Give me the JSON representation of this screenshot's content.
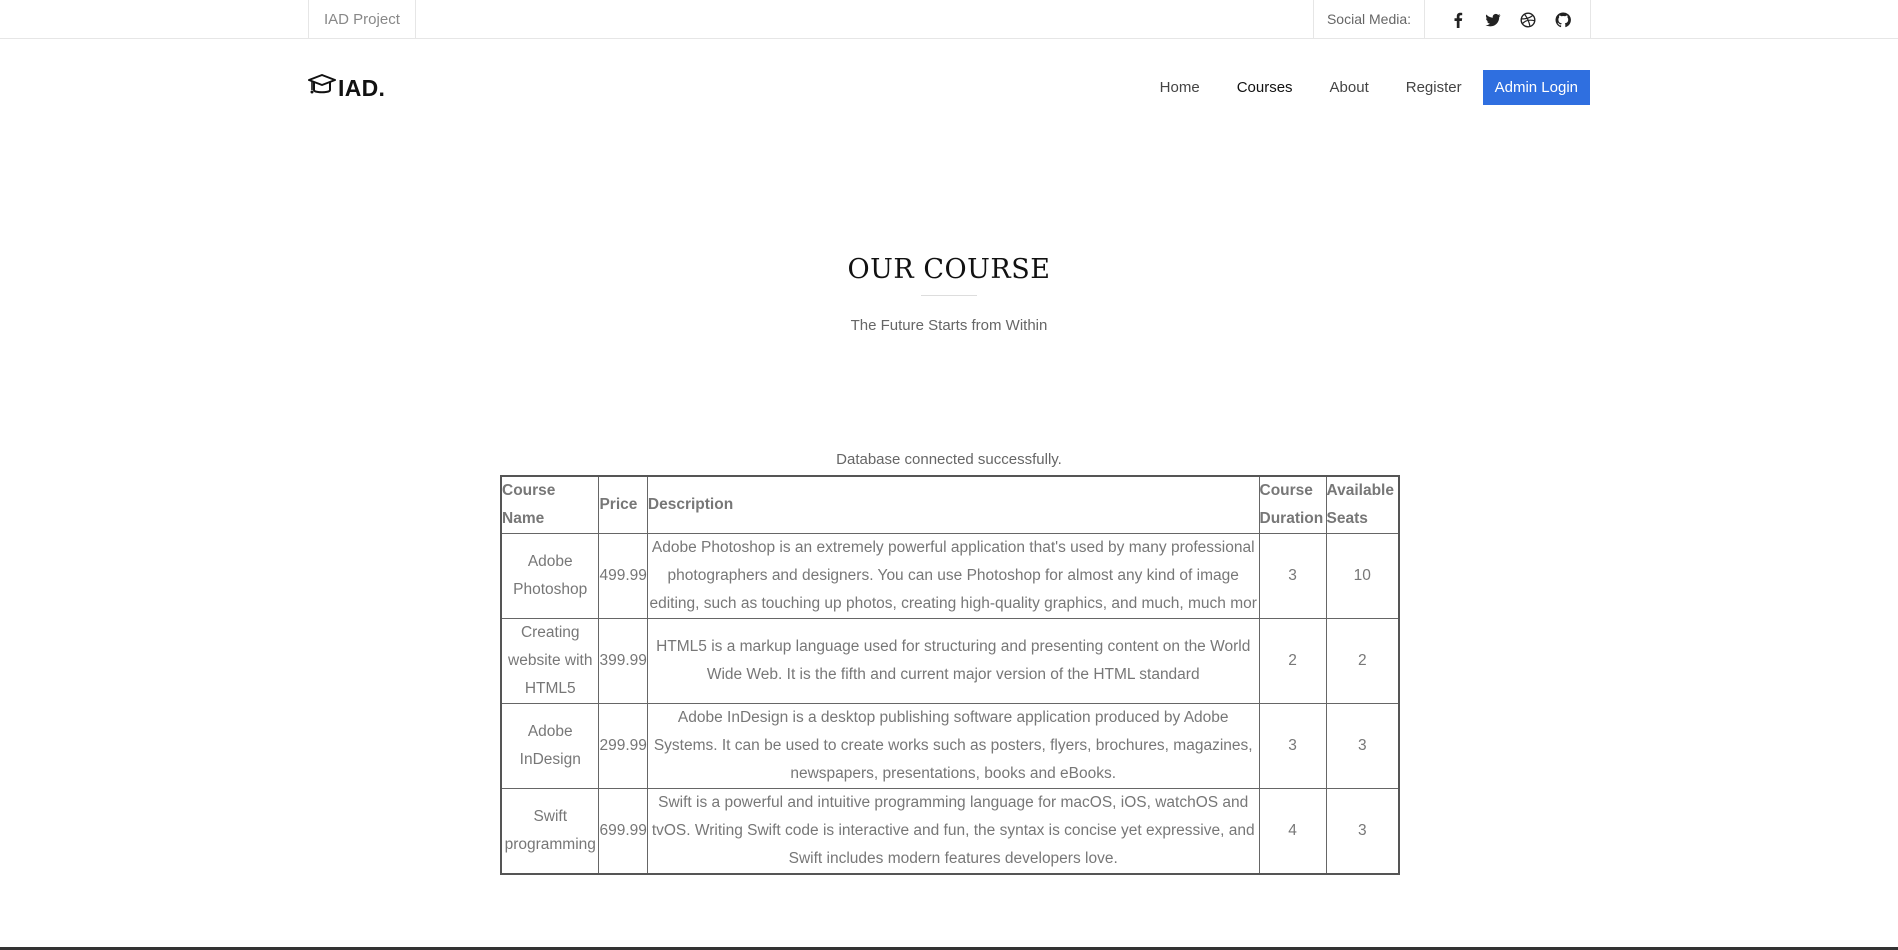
{
  "topbar": {
    "project": "IAD Project",
    "social_label": "Social Media:",
    "icons": [
      "facebook-icon",
      "twitter-icon",
      "dribbble-icon",
      "github-icon"
    ]
  },
  "header": {
    "logo_text": "IAD.",
    "logo_icon": "graduation-cap-icon",
    "nav": {
      "home": "Home",
      "courses": "Courses",
      "about": "About",
      "register": "Register",
      "admin_login": "Admin Login"
    },
    "accent_color": "#2f6fe0"
  },
  "section": {
    "title": "OUR COURSE",
    "subtitle": "The Future Starts from Within"
  },
  "db_message": "Database connected successfully.",
  "table": {
    "headers": {
      "name": "Course Name",
      "price": "Price",
      "description": "Description",
      "duration": "Course Duration",
      "seats": "Available Seats"
    },
    "rows": [
      {
        "name": "Adobe Photoshop",
        "price": "499.99",
        "description": "Adobe Photoshop is an extremely powerful application that's used by many professional photographers and designers. You can use Photoshop for almost any kind of image editing, such as touching up photos, creating high-quality graphics, and much, much mor",
        "duration": "3",
        "seats": "10"
      },
      {
        "name": "Creating website with HTML5",
        "price": "399.99",
        "description": "HTML5 is a markup language used for structuring and presenting content on the World Wide Web. It is the fifth and current major version of the HTML standard",
        "duration": "2",
        "seats": "2"
      },
      {
        "name": "Adobe InDesign",
        "price": "299.99",
        "description": "Adobe InDesign is a desktop publishing software application produced by Adobe Systems. It can be used to create works such as posters, flyers, brochures, magazines, newspapers, presentations, books and eBooks.",
        "duration": "3",
        "seats": "3"
      },
      {
        "name": "Swift programming",
        "price": "699.99",
        "description": "Swift is a powerful and intuitive programming language for macOS, iOS, watchOS and tvOS. Writing Swift code is interactive and fun, the syntax is concise yet expressive, and Swift includes modern features developers love.",
        "duration": "4",
        "seats": "3"
      }
    ]
  }
}
